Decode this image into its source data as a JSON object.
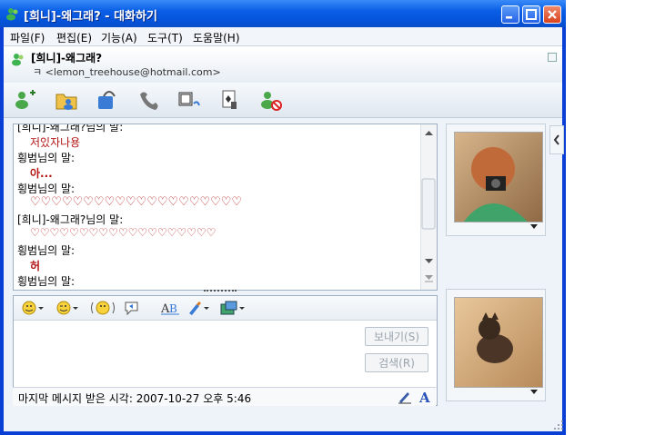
{
  "window": {
    "title": "[희니]-왜그래? - 대화하기"
  },
  "menu": [
    "파일(F)",
    "편집(E)",
    "기능(A)",
    "도구(T)",
    "도움말(H)"
  ],
  "contact": {
    "name": "[희니]-왜그래?",
    "email": "ㅋ <lemon_treehouse@hotmail.com>"
  },
  "toolbar": {
    "icons": [
      "invite-icon",
      "send-files-icon",
      "voice-icon",
      "phone-icon",
      "video-icon",
      "games-icon",
      "block-icon"
    ]
  },
  "conversation": {
    "messages": [
      {
        "text": "[희니]-왜그래?님의 말:",
        "kind": "sender"
      },
      {
        "text": "저있자나용",
        "kind": "body"
      },
      {
        "text": "힁범님의 말:",
        "kind": "sender"
      },
      {
        "text": "아...",
        "kind": "body-bold"
      },
      {
        "text": "힁범님의 말:",
        "kind": "sender"
      },
      {
        "text": "♡♡♡♡♡♡♡♡♡♡♡♡♡♡♡♡♡♡♡♡",
        "kind": "body"
      },
      {
        "text": "[희니]-왜그래?님의 말:",
        "kind": "sender"
      },
      {
        "text": "♡♡♡♡♡♡♡♡♡♡♡♡♡♡♡♡♡♡♡",
        "kind": "body"
      },
      {
        "text": "힁범님의 말:",
        "kind": "sender"
      },
      {
        "text": "허",
        "kind": "body-bold"
      },
      {
        "text": "힁범님의 말:",
        "kind": "sender"
      }
    ]
  },
  "buttons": {
    "send": "보내기(S)",
    "search": "검색(R)"
  },
  "status": {
    "last_message": "마지막 메시지 받은 시각: 2007-10-27 오후 5:46"
  },
  "colors": {
    "titlebar": "#0553d9",
    "message_text": "#b31414",
    "panel_bg": "#edf3f8"
  }
}
